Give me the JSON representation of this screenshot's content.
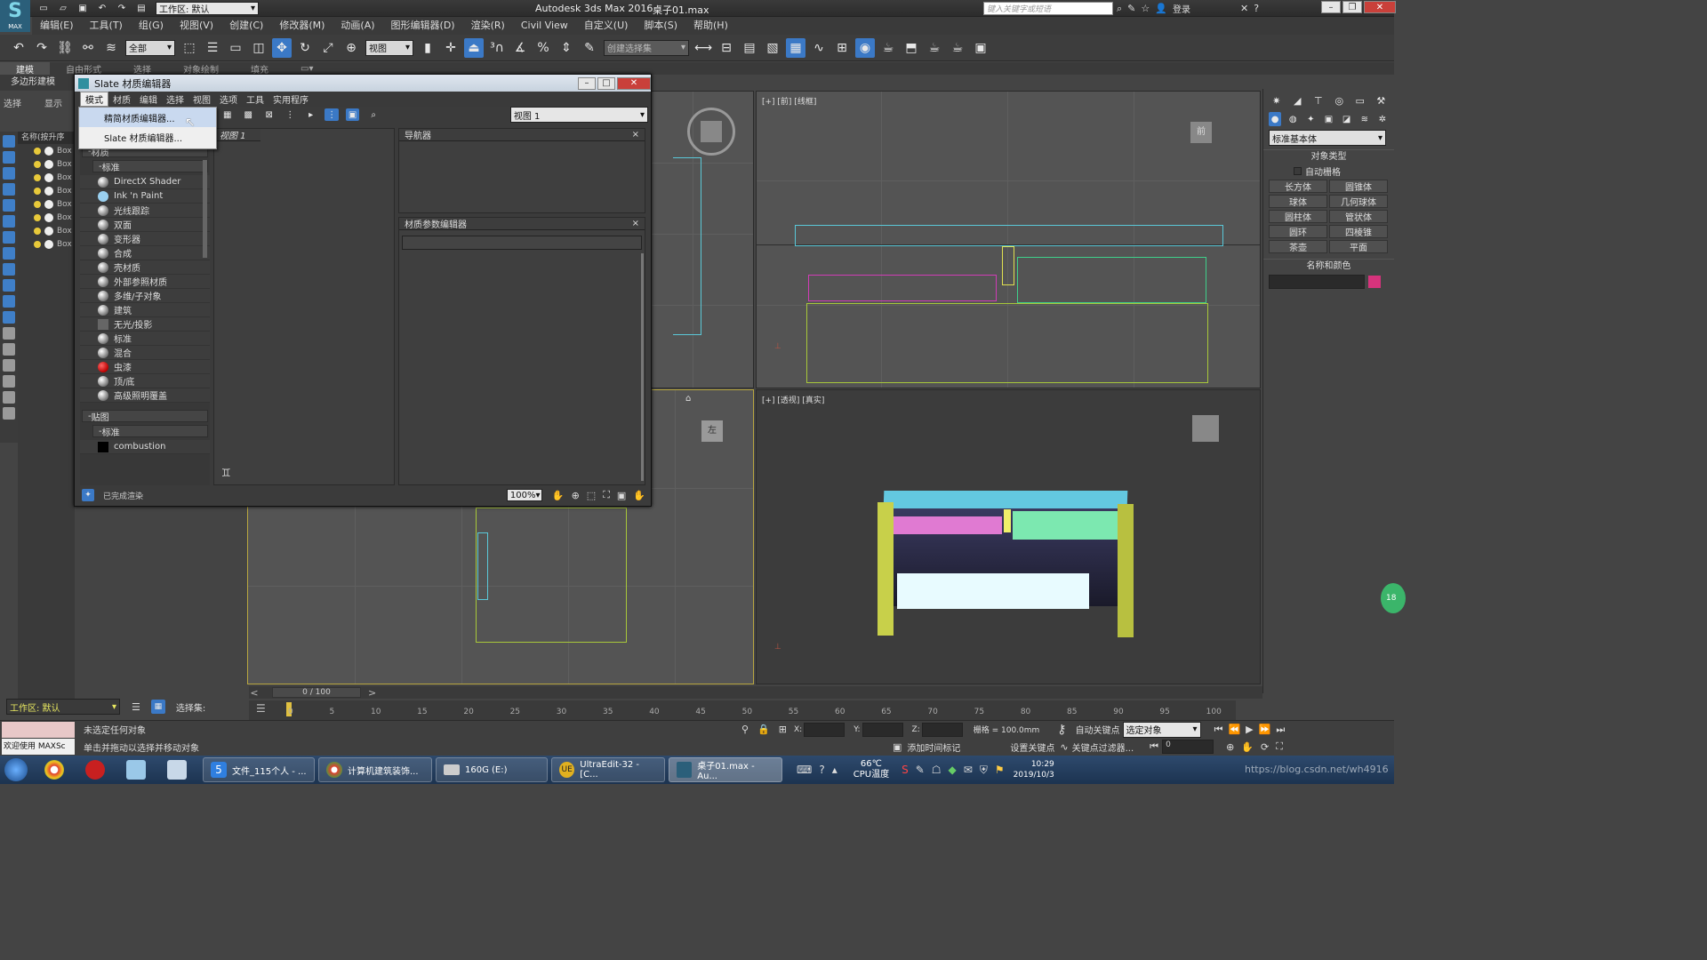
{
  "titlebar": {
    "workspace_label": "工作区: 默认",
    "app_title": "Autodesk 3ds Max 2016",
    "file_name": "桌子01.max",
    "search_placeholder": "键入关键字或短语",
    "login": "登录",
    "logo": "MAX"
  },
  "menus": [
    "编辑(E)",
    "工具(T)",
    "组(G)",
    "视图(V)",
    "创建(C)",
    "修改器(M)",
    "动画(A)",
    "图形编辑器(D)",
    "渲染(R)",
    "Civil View",
    "自定义(U)",
    "脚本(S)",
    "帮助(H)"
  ],
  "toolbar": {
    "filter_select": "全部",
    "view_select": "视图",
    "selection_set": "创建选择集"
  },
  "ribbon": {
    "tabs": [
      "建模",
      "自由形式",
      "选择",
      "对象绘制",
      "填充"
    ],
    "sub_tab": "多边形建模",
    "left_tabs": [
      "选择",
      "显示"
    ]
  },
  "scene_explorer": {
    "header": "名称(按升序",
    "item_label": "Box"
  },
  "slate": {
    "title": "Slate 材质编辑器",
    "menu": [
      "模式",
      "材质",
      "编辑",
      "选择",
      "视图",
      "选项",
      "工具",
      "实用程序"
    ],
    "mode_menu_items": [
      "精简材质编辑器...",
      "Slate 材质编辑器..."
    ],
    "view_select": "视图 1",
    "browser_section_materials": "材质",
    "browser_subsection_standard": "标准",
    "materials": [
      "DirectX Shader",
      "Ink 'n Paint",
      "光线跟踪",
      "双面",
      "变形器",
      "合成",
      "壳材质",
      "外部参照材质",
      "多维/子对象",
      "建筑",
      "无光/投影",
      "标准",
      "混合",
      "虫漆",
      "顶/底",
      "高级照明覆盖"
    ],
    "browser_section_maps": "贴图",
    "maps_subsection_standard": "标准",
    "maps": [
      "combustion"
    ],
    "view_tab": "视图 1",
    "navigator_title": "导航器",
    "param_editor_title": "材质参数编辑器",
    "status": "已完成渲染",
    "zoom": "100%",
    "panel_close": "×"
  },
  "viewports": {
    "front_label": "[+] [前] [线框]",
    "persp_label": "[+] [透视] [真实]",
    "viewcube_front": "前",
    "viewcube_left": "左"
  },
  "command_panel": {
    "category_select": "标准基本体",
    "object_type_title": "对象类型",
    "autogrid_label": "自动栅格",
    "buttons": [
      "长方体",
      "圆锥体",
      "球体",
      "几何球体",
      "圆柱体",
      "管状体",
      "圆环",
      "四棱锥",
      "茶壶",
      "平面"
    ],
    "name_color_title": "名称和颜色",
    "color": "#d6337c",
    "badge": "18"
  },
  "timeline": {
    "frame": "0 / 100",
    "ticks": [
      "0",
      "5",
      "10",
      "15",
      "20",
      "25",
      "30",
      "35",
      "40",
      "45",
      "50",
      "55",
      "60",
      "65",
      "70",
      "75",
      "80",
      "85",
      "90",
      "95",
      "100"
    ]
  },
  "status": {
    "workspace": "工作区: 默认",
    "selection_set_label": "选择集:",
    "maxscript": "欢迎使用 MAXSc",
    "no_selection": "未选定任何对象",
    "hint": "单击并拖动以选择并移动对象",
    "x_label": "X:",
    "y_label": "Y:",
    "z_label": "Z:",
    "grid": "栅格 = 100.0mm",
    "add_time_tag": "添加时间标记",
    "auto_key": "自动关键点",
    "set_key": "设置关键点",
    "selected_object": "选定对象",
    "key_filters": "关键点过滤器...",
    "frame_field": "0"
  },
  "taskbar": {
    "tasks": [
      "文件_115个人 - ...",
      "计算机建筑装饰...",
      "160G (E:)",
      "UltraEdit-32 - [C...",
      "桌子01.max - Au..."
    ],
    "temp": "66℃",
    "temp_label": "CPU温度",
    "time": "10:29",
    "date": "2019/10/3",
    "watermark": "https://blog.csdn.net/wh4916"
  }
}
